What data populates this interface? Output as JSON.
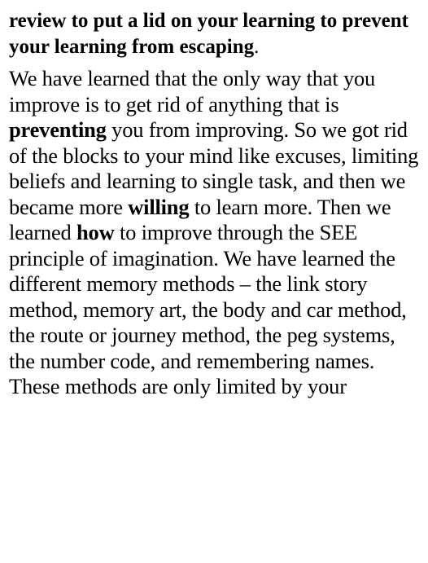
{
  "intro": {
    "bold_text": "review to put a lid on your learning to prevent your learning from escaping",
    "tail": "."
  },
  "paragraph": {
    "s1": "We have learned that the only way that you improve is to get rid of anything that is ",
    "b1": "preventing",
    "s2": " you from improving. So we got rid of the blocks to your mind like excuses, limiting beliefs and learning to single task, and then we became more ",
    "b2": "willing",
    "s3": " to learn more. Then we learned ",
    "b3": "how",
    "s4": " to improve through the SEE principle of imagination. We have learned the different memory methods – the link story method, memory art, the body and car method, the route or journey method, the peg systems, the number code, and remembering names. These methods are only limited by your"
  }
}
